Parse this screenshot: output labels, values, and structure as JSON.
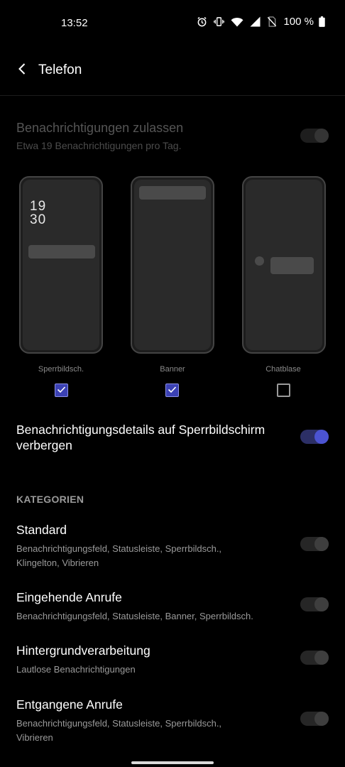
{
  "status_bar": {
    "time": "13:52",
    "battery": "100 %",
    "icons": [
      "alarm-icon",
      "vibrate-icon",
      "wifi-icon",
      "signal-icon",
      "no-sim-icon",
      "battery-icon"
    ]
  },
  "app_bar": {
    "title": "Telefon",
    "back_icon": "chevron-left-icon"
  },
  "allow_notifications": {
    "title": "Benachrichtigungen zulassen",
    "subtitle": "Etwa 19 Benachrichtigungen pro Tag.",
    "enabled": true,
    "disabled_look": true
  },
  "styles": [
    {
      "label": "Sperrbildsch.",
      "checked": true,
      "clock": [
        "19",
        "30"
      ]
    },
    {
      "label": "Banner",
      "checked": true
    },
    {
      "label": "Chatblase",
      "checked": false
    }
  ],
  "hide_details": {
    "title": "Benachrichtigungsdetails auf Sperrbildschirm verbergen",
    "enabled": true
  },
  "categories": {
    "header": "KATEGORIEN",
    "items": [
      {
        "title": "Standard",
        "subtitle": "Benachrichtigungsfeld, Statusleiste, Sperrbildsch., Klingelton, Vibrieren",
        "enabled": false
      },
      {
        "title": "Eingehende Anrufe",
        "subtitle": "Benachrichtigungsfeld, Statusleiste, Banner, Sperrbildsch.",
        "enabled": false
      },
      {
        "title": "Hintergrundverarbeitung",
        "subtitle": "Lautlose Benachrichtigungen",
        "enabled": false
      },
      {
        "title": "Entgangene Anrufe",
        "subtitle": "Benachrichtigungsfeld, Statusleiste, Sperrbildsch., Vibrieren",
        "enabled": false
      }
    ]
  },
  "colors": {
    "accent": "#4b53d1",
    "background": "#000000"
  }
}
